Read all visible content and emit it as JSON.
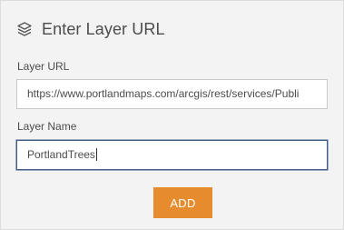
{
  "header": {
    "icon": "layers-icon",
    "title": "Enter Layer URL"
  },
  "form": {
    "url_label": "Layer URL",
    "url_value": "https://www.portlandmaps.com/arcgis/rest/services/Publi",
    "name_label": "Layer Name",
    "name_value": "PortlandTrees"
  },
  "actions": {
    "add_label": "ADD"
  },
  "colors": {
    "panel_background": "#f3f3f3",
    "accent_button": "#e78c2e",
    "focus_border": "#405f88",
    "text": "#4c4c4c"
  }
}
